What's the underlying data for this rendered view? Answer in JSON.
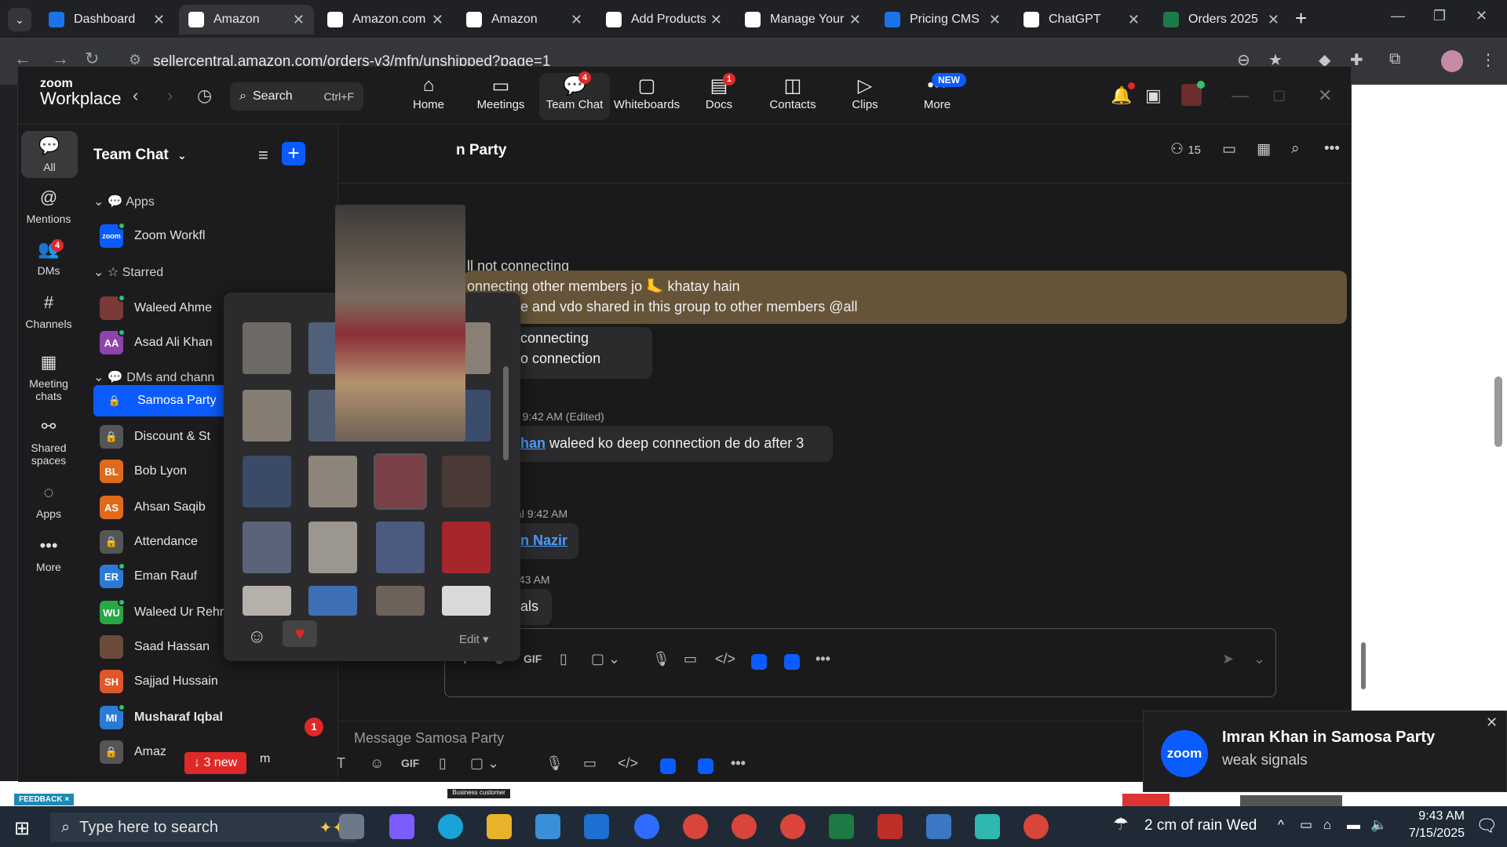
{
  "browser": {
    "tabs": [
      {
        "label": "Dashboard",
        "icon": "dashboard-icon",
        "color": "#1a73e8"
      },
      {
        "label": "Amazon",
        "icon": "amazon-icon",
        "color": "#ffffff"
      },
      {
        "label": "Amazon.com",
        "icon": "amazon-icon",
        "color": "#ffffff"
      },
      {
        "label": "Amazon",
        "icon": "amazon-icon",
        "color": "#ffffff"
      },
      {
        "label": "Add Products",
        "icon": "amazon-icon",
        "color": "#ffffff"
      },
      {
        "label": "Manage Your",
        "icon": "amazon-icon",
        "color": "#ffffff"
      },
      {
        "label": "Pricing CMS",
        "icon": "dollar-icon",
        "color": "#1a73e8"
      },
      {
        "label": "ChatGPT",
        "icon": "chatgpt-icon",
        "color": "#ffffff"
      },
      {
        "label": "Orders 2025",
        "icon": "excel-icon",
        "color": "#1d7a45"
      }
    ],
    "url": "sellercentral.amazon.com/orders-v3/mfn/unshipped?page=1"
  },
  "zoom": {
    "logo_top": "zoom",
    "logo_bottom": "Workplace",
    "search_label": "Search",
    "search_shortcut": "Ctrl+F",
    "nav": [
      {
        "label": "Home",
        "icon": "⌂",
        "badge": ""
      },
      {
        "label": "Meetings",
        "icon": "▭",
        "badge": ""
      },
      {
        "label": "Team Chat",
        "icon": "💬",
        "badge": "4"
      },
      {
        "label": "Whiteboards",
        "icon": "▢",
        "badge": ""
      },
      {
        "label": "Docs",
        "icon": "▤",
        "badge": "1"
      },
      {
        "label": "Contacts",
        "icon": "◫",
        "badge": ""
      },
      {
        "label": "Clips",
        "icon": "▷",
        "badge": ""
      },
      {
        "label": "More",
        "icon": "•••",
        "badge": "NEW"
      }
    ],
    "rail": [
      {
        "label": "All",
        "icon": "💬"
      },
      {
        "label": "Mentions",
        "icon": "@"
      },
      {
        "label": "DMs",
        "icon": "👥",
        "badge": "4"
      },
      {
        "label": "Channels",
        "icon": "#"
      },
      {
        "label": "Meeting chats",
        "icon": "▦"
      },
      {
        "label": "Shared spaces",
        "icon": "⚯"
      },
      {
        "label": "Apps",
        "icon": "◌"
      },
      {
        "label": "More",
        "icon": "•••"
      }
    ],
    "sidebar": {
      "title": "Team Chat",
      "sections": {
        "apps": "Apps",
        "starred": "Starred",
        "dms": "DMs and chann"
      },
      "items": [
        {
          "label": "Zoom Workfl",
          "initials": "zoom",
          "color": "#0b5cff"
        },
        {
          "label": "Waleed Ahme",
          "initials": "",
          "color": "#7a3a3a"
        },
        {
          "label": "Asad Ali Khan",
          "initials": "AA",
          "color": "#8e44ad"
        },
        {
          "label": "Samosa Party",
          "initials": "🔒",
          "color": "transparent"
        },
        {
          "label": "Discount & St",
          "initials": "🔒",
          "color": "#555555"
        },
        {
          "label": "Bob Lyon",
          "initials": "BL",
          "color": "#e06a1b"
        },
        {
          "label": "Ahsan Saqib",
          "initials": "AS",
          "color": "#e06a1b"
        },
        {
          "label": "Attendance",
          "initials": "🔒",
          "color": "#555555"
        },
        {
          "label": "Eman Rauf",
          "initials": "ER",
          "color": "#2b7bd6"
        },
        {
          "label": "Waleed Ur Rehman",
          "initials": "WU",
          "color": "#27a745"
        },
        {
          "label": "Saad Hassan",
          "initials": "",
          "color": "#6b4a3a"
        },
        {
          "label": "Sajjad Hussain",
          "initials": "SH",
          "color": "#e0572a"
        },
        {
          "label": "Musharaf Iqbal",
          "initials": "MI",
          "color": "#2b7bd6"
        },
        {
          "label": "Amaz",
          "initials": "🔒",
          "color": "#555555"
        }
      ],
      "unread_musharaf": "1",
      "new_pill": "↓ 3 new",
      "trailing_fragment": "m"
    },
    "chat": {
      "title": "n Party",
      "member_count": "15",
      "lines": {
        "l1": "ll not connecting",
        "l2": "onnecting other members jo 🦶 khatay hain",
        "l3": "ny picture and vdo shared in this group to other members @all",
        "l4": "connecting",
        "l5": "o connection",
        "meta1": "r 9:42 AM (Edited)",
        "mention1": "han",
        "l6": " waleed ko deep connection de do after 3",
        "meta2": "al 9:42 AM",
        "mention2": "n Nazir",
        "meta3": ":43 AM",
        "l7": "als"
      },
      "composer_placeholder": "Message Samosa Party"
    },
    "picker": {
      "edit_label": "Edit ▾"
    }
  },
  "toast": {
    "logo": "zoom",
    "title": "Imran Khan in Samosa Party",
    "body": "weak signals"
  },
  "bgpage": {
    "feedback": "FEEDBACK ×",
    "business": "Business customer"
  },
  "taskbar": {
    "search_placeholder": "Type here to search",
    "weather": "2 cm of rain Wed",
    "time": "9:43 AM",
    "date": "7/15/2025"
  }
}
